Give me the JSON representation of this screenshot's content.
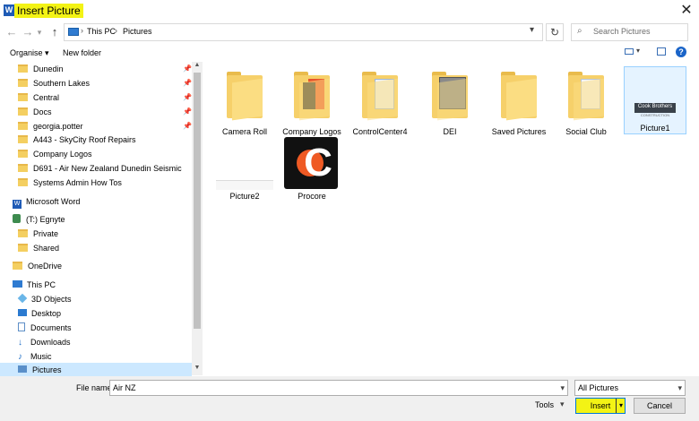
{
  "window": {
    "title": "Insert Picture",
    "close_glyph": "✕",
    "title_icon_letter": "W"
  },
  "address": {
    "back_glyph": "←",
    "forward_glyph": "→",
    "recent_glyph": "▾",
    "up_glyph": "↑",
    "breadcrumb": [
      "This PC",
      "Pictures"
    ],
    "separator": "›",
    "dropdown_glyph": "▾",
    "refresh_glyph": "↻",
    "search_placeholder": "Search Pictures"
  },
  "toolbar": {
    "organise_label": "Organise ▾",
    "new_folder_label": "New folder",
    "help_glyph": "?"
  },
  "nav": {
    "quick_access": [
      {
        "label": "Dunedin",
        "pinned": true
      },
      {
        "label": "Southern Lakes",
        "pinned": true
      },
      {
        "label": "Central",
        "pinned": true
      },
      {
        "label": "Docs",
        "pinned": true
      },
      {
        "label": "georgia.potter",
        "pinned": true
      },
      {
        "label": "A443 - SkyCity Roof Repairs",
        "pinned": false
      },
      {
        "label": "Company Logos",
        "pinned": false
      },
      {
        "label": "D691 - Air New Zealand Dunedin Seismic",
        "pinned": false
      },
      {
        "label": "Systems Admin How Tos",
        "pinned": false
      }
    ],
    "word": "Microsoft Word",
    "egnyte": "(T:) Egnyte",
    "egnyte_children": [
      "Private",
      "Shared"
    ],
    "onedrive": "OneDrive",
    "this_pc": "This PC",
    "this_pc_children": [
      "3D Objects",
      "Desktop",
      "Documents",
      "Downloads",
      "Music",
      "Pictures"
    ],
    "pin_glyph": "📌"
  },
  "content": {
    "items": [
      {
        "label": "Camera Roll",
        "type": "folder"
      },
      {
        "label": "Company Logos",
        "type": "folder"
      },
      {
        "label": "ControlCenter4",
        "type": "folder"
      },
      {
        "label": "DEI",
        "type": "folder"
      },
      {
        "label": "Saved Pictures",
        "type": "folder"
      },
      {
        "label": "Social Club",
        "type": "folder"
      },
      {
        "label": "Picture1",
        "type": "image"
      },
      {
        "label": "Picture2",
        "type": "image"
      },
      {
        "label": "Procore",
        "type": "image"
      }
    ],
    "picture1_text": "Cook Brothers",
    "picture1_subtext": "CONSTRUCTION",
    "procore_letter": "C"
  },
  "bottom": {
    "filename_label": "File name:",
    "filename_value": "Air NZ",
    "filter_value": "All Pictures",
    "tools_label": "Tools",
    "insert_label": "Insert",
    "cancel_label": "Cancel",
    "dropdown_glyph": "▾"
  }
}
